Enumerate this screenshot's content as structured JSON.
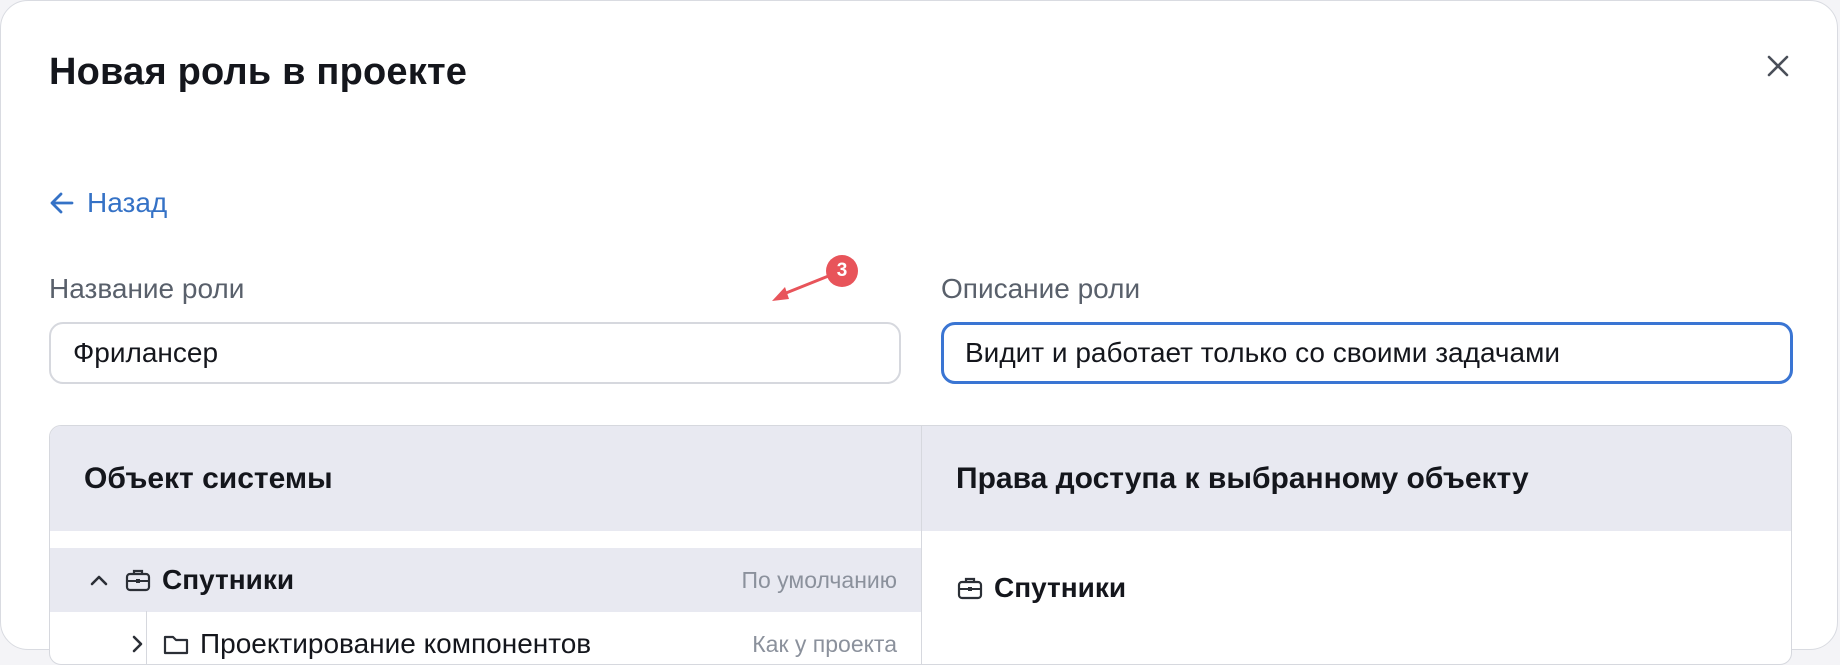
{
  "dialog": {
    "title": "Новая роль в проекте",
    "back_label": "Назад"
  },
  "form": {
    "role_name_label": "Название роли",
    "role_name_value": "Фрилансер",
    "role_description_label": "Описание роли",
    "role_description_value": "Видит и работает только со своими задачами"
  },
  "annotation": {
    "step_number": "3"
  },
  "table": {
    "left_header": "Объект системы",
    "right_header": "Права доступа к выбранному объекту",
    "rows": [
      {
        "label": "Спутники",
        "hint": "По умолчанию",
        "icon": "briefcase-icon",
        "expanded": true
      },
      {
        "label": "Проектирование компонентов",
        "hint": "Как у проекта",
        "icon": "folder-icon",
        "expanded": false
      }
    ],
    "selected_object": "Спутники"
  },
  "colors": {
    "accent": "#3572c6",
    "focus_border": "#3a75d3",
    "badge": "#e8545a",
    "header_bg": "#e8e9f1"
  }
}
